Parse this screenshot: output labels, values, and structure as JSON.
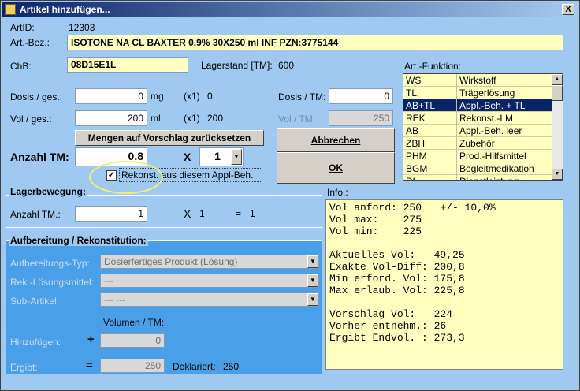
{
  "window": {
    "title": "Artikel hinzufügen...",
    "close_glyph": "X"
  },
  "article": {
    "artid_label": "ArtID:",
    "artid": "12303",
    "bez_label": "Art.-Bez.:",
    "bez": "ISOTONE NA CL BAXTER 0.9%   30X250 ml INF  PZN:3775144",
    "chb_label": "ChB:",
    "chb": "08D15E1L",
    "lager_label": "Lagerstand [TM]:",
    "lager": "600"
  },
  "dose": {
    "dosis_label": "Dosis / ges.:",
    "dosis": "0",
    "dosis_unit": "mg",
    "dosis_x1": "(x1)",
    "dosis_x1_val": "0",
    "vol_label": "Vol / ges.:",
    "vol": "200",
    "vol_unit": "ml",
    "vol_x1": "(x1)",
    "vol_x1_val": "200",
    "dosis_tm_label": "Dosis / TM:",
    "dosis_tm": "0",
    "vol_tm_label": "Vol  / TM:",
    "vol_tm": "250",
    "reset_button": "Mengen auf Vorschlag zurücksetzen",
    "anzahl_label": "Anzahl TM:",
    "anzahl": "0.8",
    "x_label": "X",
    "multiplier": "1",
    "rekonst_checked": "✓",
    "rekonst_label": "Rekonst. aus diesem  Appl-Beh."
  },
  "buttons": {
    "abbrechen": "Abbrechen",
    "ok": "OK"
  },
  "function_list": {
    "label": "Art.-Funktion:",
    "selected_index": 2,
    "items": [
      {
        "code": "WS",
        "name": "Wirkstoff"
      },
      {
        "code": "TL",
        "name": "Trägerlösung"
      },
      {
        "code": "AB+TL",
        "name": "Appl.-Beh. + TL"
      },
      {
        "code": "REK",
        "name": "Rekonst.-LM"
      },
      {
        "code": "AB",
        "name": "Appl.-Beh. leer"
      },
      {
        "code": "ZBH",
        "name": "Zubehör"
      },
      {
        "code": "PHM",
        "name": "Prod.-Hilfsmittel"
      },
      {
        "code": "BGM",
        "name": "Begleitmedikation"
      },
      {
        "code": "DL",
        "name": "Dienstleistung"
      }
    ]
  },
  "lager": {
    "title": "Lagerbewegung:",
    "anzahl_label": "Anzahl TM.:",
    "anzahl": "1",
    "x": "X",
    "x_val": "1",
    "eq": "=",
    "eq_val": "1"
  },
  "aufbereitung": {
    "title": "Aufbereitung / Rekonstitution:",
    "typ_label": "Aufbereitungs-Typ:",
    "typ": "Dosierfertiges Produkt (Lösung)",
    "rek_label": "Rek.-Lösungsmittel:",
    "rek": "---",
    "sub_label": "Sub-Artikel:",
    "sub": "---  ---",
    "volumen_label": "Volumen / TM:",
    "hinzu_label": "Hinzufügen:",
    "plus": "+",
    "hinzu": "0",
    "ergibt_label": "Ergibt:",
    "eq": "=",
    "ergibt": "250",
    "deklariert_label": "Deklariert:",
    "deklariert": "250"
  },
  "info": {
    "label": "Info.:",
    "text": "Vol anford: 250   +/- 10,0%\nVol max:    275\nVol min:    225\n\nAktuelles Vol:   49,25\nExakte Vol-Diff: 200,8\nMin erford. Vol: 175,8\nMax erlaub. Vol: 225,8\n\nVorschlag Vol:   224\nVorher entnehm.: 26\nErgibt Endvol. : 273,3"
  }
}
